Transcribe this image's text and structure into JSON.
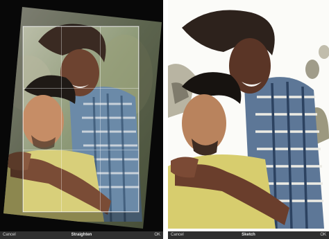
{
  "left_panel": {
    "toolbar": {
      "cancel_label": "Cancel",
      "title": "Straighten",
      "ok_label": "OK"
    },
    "icons": {
      "crop_overlay": "crop-grid-icon"
    }
  },
  "right_panel": {
    "toolbar": {
      "cancel_label": "Cancel",
      "title": "Sketch",
      "ok_label": "OK"
    }
  },
  "colors": {
    "toolbar_bg": "#2f2f2f",
    "toolbar_text": "#d8d8d8",
    "divider": "#ffffff",
    "editor_bg": "#111111"
  }
}
